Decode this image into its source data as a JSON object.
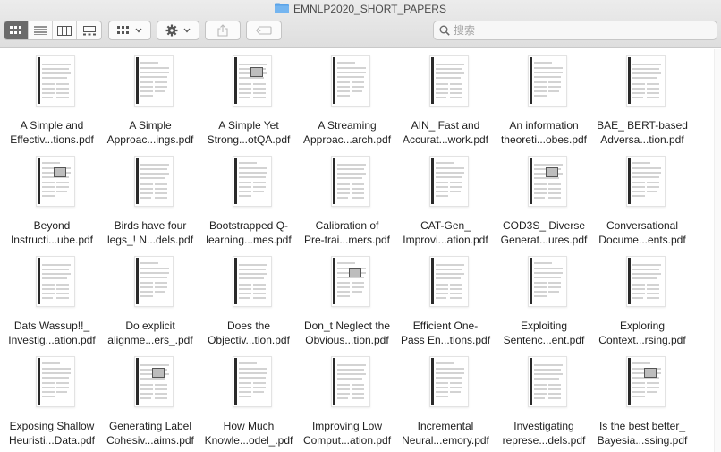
{
  "window": {
    "title": "EMNLP2020_SHORT_PAPERS",
    "folder_icon": "folder-icon",
    "accent": "#5aa3e8"
  },
  "toolbar": {
    "view_buttons": [
      {
        "name": "icon-view",
        "icon": "grid-icon",
        "active": true
      },
      {
        "name": "list-view",
        "icon": "list-icon",
        "active": false
      },
      {
        "name": "column-view",
        "icon": "columns-icon",
        "active": false
      },
      {
        "name": "gallery-view",
        "icon": "gallery-icon",
        "active": false
      }
    ],
    "group_button_icon": "group-grid-icon",
    "action_button_icon": "gear-icon",
    "share_button_icon": "share-icon",
    "tag_button_icon": "tag-icon",
    "search": {
      "placeholder": "搜索",
      "value": ""
    }
  },
  "files": [
    {
      "line1": "A Simple and",
      "line2": "Effectiv...tions.pdf"
    },
    {
      "line1": "A Simple",
      "line2": "Approac...ings.pdf"
    },
    {
      "line1": "A Simple Yet",
      "line2": "Strong...otQA.pdf"
    },
    {
      "line1": "A Streaming",
      "line2": "Approac...arch.pdf"
    },
    {
      "line1": "AIN_ Fast and",
      "line2": "Accurat...work.pdf"
    },
    {
      "line1": "An information",
      "line2": "theoreti...obes.pdf"
    },
    {
      "line1": "BAE_ BERT-based",
      "line2": "Adversa...tion.pdf"
    },
    {
      "line1": "Beyond",
      "line2": "Instructi...ube.pdf"
    },
    {
      "line1": "Birds have four",
      "line2": "legs_! N...dels.pdf"
    },
    {
      "line1": "Bootstrapped Q-",
      "line2": "learning...mes.pdf"
    },
    {
      "line1": "Calibration of",
      "line2": "Pre-trai...mers.pdf"
    },
    {
      "line1": "CAT-Gen_",
      "line2": "Improvi...ation.pdf"
    },
    {
      "line1": "COD3S_ Diverse",
      "line2": "Generat...ures.pdf"
    },
    {
      "line1": "Conversational",
      "line2": "Docume...ents.pdf"
    },
    {
      "line1": "Dats Wassup!!_",
      "line2": "Investig...ation.pdf"
    },
    {
      "line1": "Do explicit",
      "line2": "alignme...ers_.pdf"
    },
    {
      "line1": "Does the",
      "line2": "Objectiv...tion.pdf"
    },
    {
      "line1": "Don_t Neglect the",
      "line2": "Obvious...tion.pdf"
    },
    {
      "line1": "Efficient One-",
      "line2": "Pass En...tions.pdf"
    },
    {
      "line1": "Exploiting",
      "line2": "Sentenc...ent.pdf"
    },
    {
      "line1": "Exploring",
      "line2": "Context...rsing.pdf"
    },
    {
      "line1": "Exposing Shallow",
      "line2": "Heuristi...Data.pdf"
    },
    {
      "line1": "Generating Label",
      "line2": "Cohesiv...aims.pdf"
    },
    {
      "line1": "How Much",
      "line2": "Knowle...odel_.pdf"
    },
    {
      "line1": "Improving Low",
      "line2": "Comput...ation.pdf"
    },
    {
      "line1": "Incremental",
      "line2": "Neural...emory.pdf"
    },
    {
      "line1": "Investigating",
      "line2": "represe...dels.pdf"
    },
    {
      "line1": "Is the best better_",
      "line2": "Bayesia...ssing.pdf"
    }
  ]
}
